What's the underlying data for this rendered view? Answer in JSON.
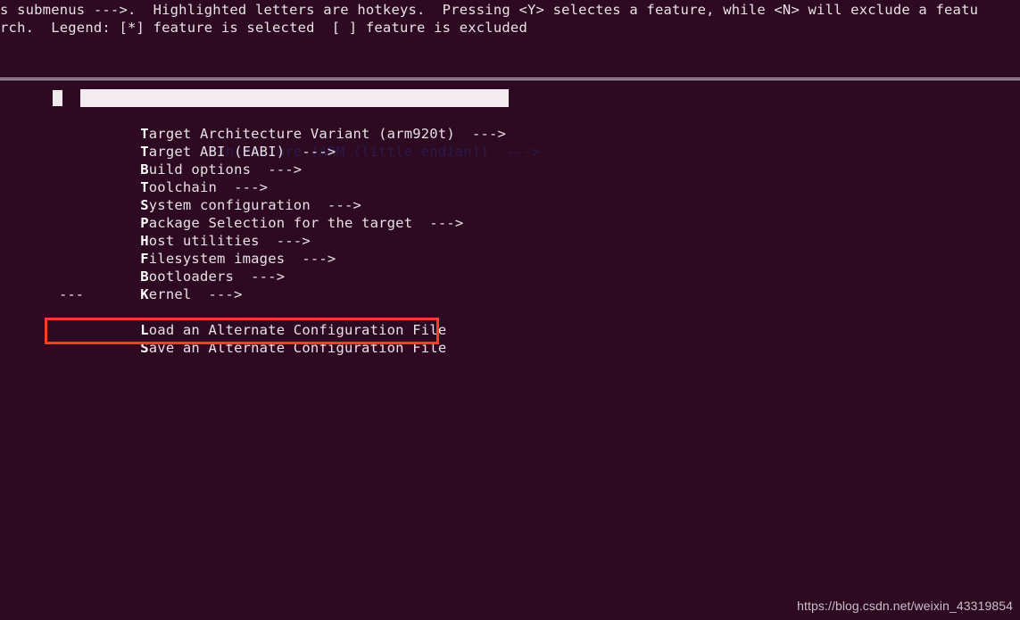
{
  "terminal": {
    "background_color": "#2d0922",
    "foreground_color": "#e8e2e4"
  },
  "help": {
    "line1": "s submenus --->.  Highlighted letters are hotkeys.  Pressing <Y> selectes a feature, while <N> will exclude a featu",
    "line2": "rch.  Legend: [*] feature is selected  [ ] feature is excluded"
  },
  "menu": {
    "separator": "---",
    "items": [
      {
        "hotkey": "T",
        "rest": "arget Architecture (ARM (little endian))  --->",
        "selected": true
      },
      {
        "hotkey": "T",
        "rest": "arget Architecture Variant (arm920t)  --->",
        "selected": false
      },
      {
        "hotkey": "T",
        "rest": "arget ABI (EABI)  --->",
        "selected": false
      },
      {
        "hotkey": "B",
        "rest": "uild options  --->",
        "selected": false
      },
      {
        "hotkey": "T",
        "rest": "oolchain  --->",
        "selected": false
      },
      {
        "hotkey": "S",
        "rest": "ystem configuration  --->",
        "selected": false
      },
      {
        "hotkey": "P",
        "rest": "ackage Selection for the target  --->",
        "selected": false
      },
      {
        "hotkey": "H",
        "rest": "ost utilities  --->",
        "selected": false
      },
      {
        "hotkey": "F",
        "rest": "ilesystem images  --->",
        "selected": false
      },
      {
        "hotkey": "B",
        "rest": "ootloaders  --->",
        "selected": false
      },
      {
        "hotkey": "K",
        "rest": "ernel  --->",
        "selected": false
      }
    ],
    "footer_items": [
      {
        "hotkey": "L",
        "rest": "oad an Alternate Configuration File",
        "selected": false
      },
      {
        "hotkey": "S",
        "rest": "ave an Alternate Configuration File",
        "selected": false
      }
    ]
  },
  "annotation": {
    "color": "#fc3b30",
    "target_label": "Save an Alternate Configuration File"
  },
  "watermark": {
    "text": "https://blog.csdn.net/weixin_43319854"
  }
}
